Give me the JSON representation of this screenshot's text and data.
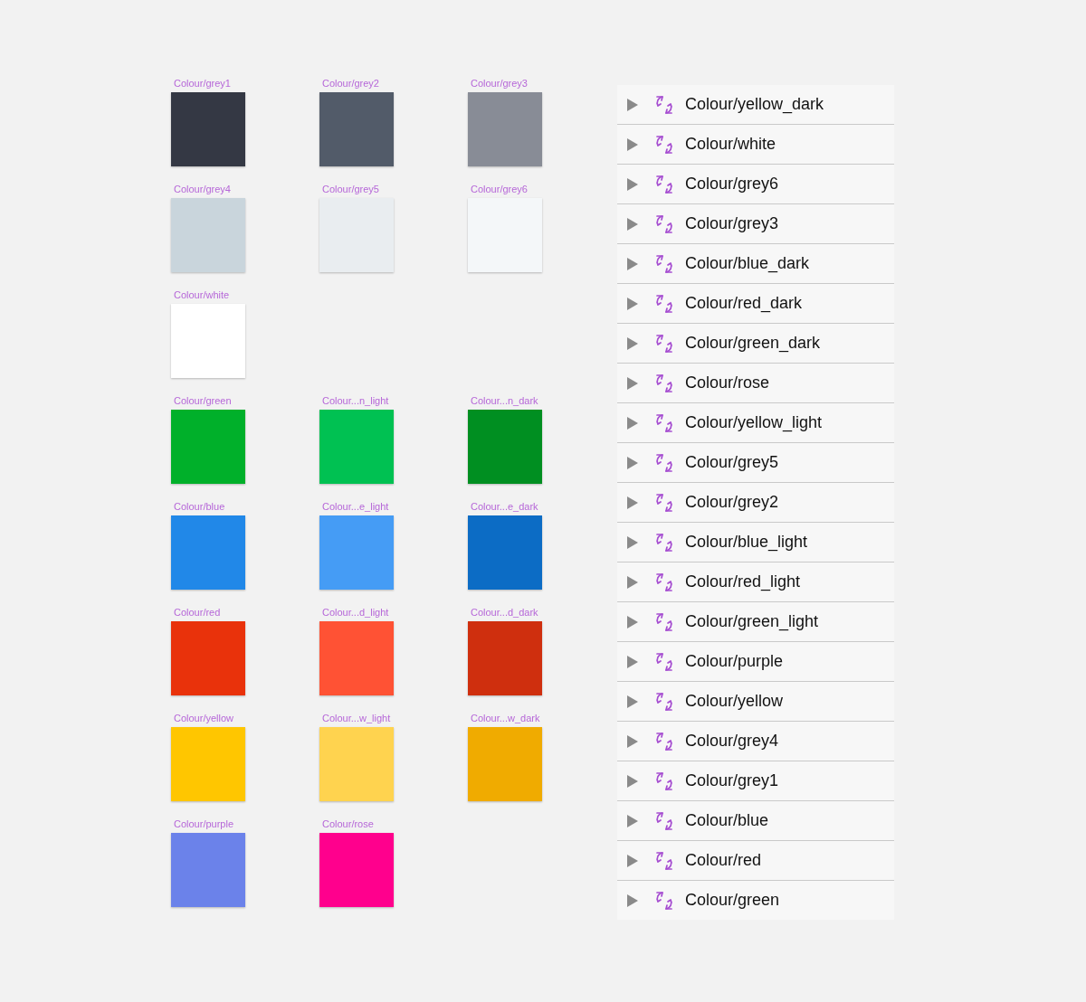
{
  "swatch_rows": [
    [
      {
        "label": "Colour/grey1",
        "color": "#343844"
      },
      {
        "label": "Colour/grey2",
        "color": "#525b69"
      },
      {
        "label": "Colour/grey3",
        "color": "#888c96"
      }
    ],
    [
      {
        "label": "Colour/grey4",
        "color": "#c9d5dc"
      },
      {
        "label": "Colour/grey5",
        "color": "#e9edf0"
      },
      {
        "label": "Colour/grey6",
        "color": "#f4f7f9"
      }
    ],
    [
      {
        "label": "Colour/white",
        "color": "#ffffff"
      }
    ],
    [
      {
        "label": "Colour/green",
        "color": "#00b02a"
      },
      {
        "label": "Colour...n_light",
        "color": "#00c152"
      },
      {
        "label": "Colour...n_dark",
        "color": "#008f21"
      }
    ],
    [
      {
        "label": "Colour/blue",
        "color": "#2188e8"
      },
      {
        "label": "Colour...e_light",
        "color": "#459cf5"
      },
      {
        "label": "Colour...e_dark",
        "color": "#0c6cc5"
      }
    ],
    [
      {
        "label": "Colour/red",
        "color": "#e9320b"
      },
      {
        "label": "Colour...d_light",
        "color": "#ff5234"
      },
      {
        "label": "Colour...d_dark",
        "color": "#cf2f0e"
      }
    ],
    [
      {
        "label": "Colour/yellow",
        "color": "#ffc600"
      },
      {
        "label": "Colour...w_light",
        "color": "#ffd34f"
      },
      {
        "label": "Colour...w_dark",
        "color": "#f0ab00"
      }
    ],
    [
      {
        "label": "Colour/purple",
        "color": "#6b82ea"
      },
      {
        "label": "Colour/rose",
        "color": "#ff008d"
      }
    ]
  ],
  "symbol_list": [
    {
      "name": "Colour/yellow_dark",
      "expanded": false
    },
    {
      "name": "Colour/white",
      "expanded": false
    },
    {
      "name": "Colour/grey6",
      "expanded": false
    },
    {
      "name": "Colour/grey3",
      "expanded": false
    },
    {
      "name": "Colour/blue_dark",
      "expanded": false
    },
    {
      "name": "Colour/red_dark",
      "expanded": false
    },
    {
      "name": "Colour/green_dark",
      "expanded": false
    },
    {
      "name": "Colour/rose",
      "expanded": false
    },
    {
      "name": "Colour/yellow_light",
      "expanded": false
    },
    {
      "name": "Colour/grey5",
      "expanded": false
    },
    {
      "name": "Colour/grey2",
      "expanded": false
    },
    {
      "name": "Colour/blue_light",
      "expanded": false
    },
    {
      "name": "Colour/red_light",
      "expanded": false
    },
    {
      "name": "Colour/green_light",
      "expanded": false
    },
    {
      "name": "Colour/purple",
      "expanded": false
    },
    {
      "name": "Colour/yellow",
      "expanded": false
    },
    {
      "name": "Colour/grey4",
      "expanded": false
    },
    {
      "name": "Colour/grey1",
      "expanded": false
    },
    {
      "name": "Colour/blue",
      "expanded": false
    },
    {
      "name": "Colour/red",
      "expanded": false
    },
    {
      "name": "Colour/green",
      "expanded": false
    }
  ]
}
